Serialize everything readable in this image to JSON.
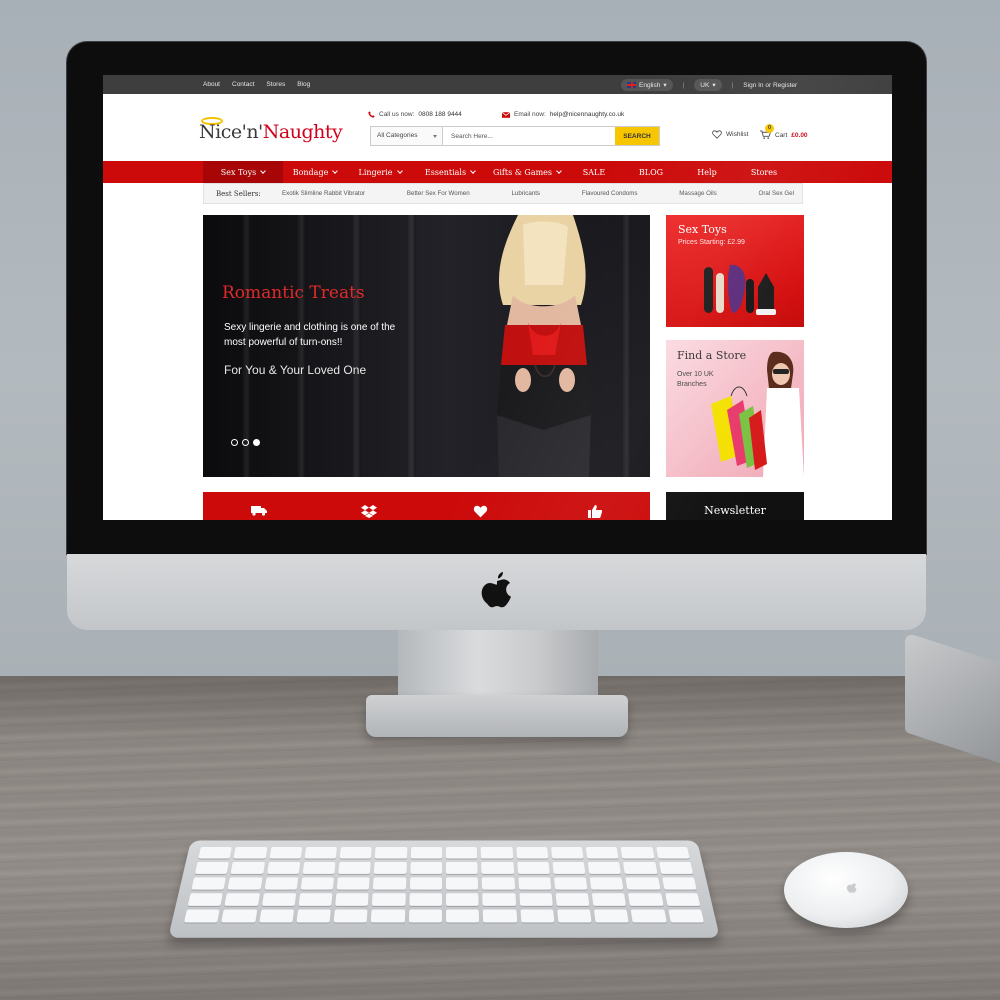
{
  "topbar": {
    "links": [
      "About",
      "Contact",
      "Stores",
      "Blog"
    ],
    "language": "English",
    "region": "UK",
    "sign_in": "Sign In",
    "or": "or",
    "register": "Register"
  },
  "header": {
    "logo": {
      "part1": "Nice",
      "part2": "'n'",
      "part3": "Naughty"
    },
    "call_label": "Call us now:",
    "phone": "0808 188 9444",
    "email_label": "Email now:",
    "email": "help@nicennaughty.co.uk",
    "search_category": "All Categories",
    "search_placeholder": "Search Here...",
    "search_button": "SEARCH",
    "wishlist": "Wishlist",
    "cart_count": "0",
    "cart_label": "Cart",
    "cart_total": "£0.00"
  },
  "nav": {
    "items": [
      {
        "label": "Sex Toys",
        "dropdown": true
      },
      {
        "label": "Bondage",
        "dropdown": true
      },
      {
        "label": "Lingerie",
        "dropdown": true
      },
      {
        "label": "Essentials",
        "dropdown": true
      },
      {
        "label": "Gifts & Games",
        "dropdown": true
      },
      {
        "label": "SALE",
        "dropdown": false
      },
      {
        "label": "BLOG",
        "dropdown": false
      },
      {
        "label": "Help",
        "dropdown": false
      },
      {
        "label": "Stores",
        "dropdown": false
      }
    ]
  },
  "best_sellers": {
    "label": "Best Sellers:",
    "items": [
      "Exotik Slimline Rabbit Vibrator",
      "Better Sex For Women",
      "Lubricants",
      "Flavoured Condoms",
      "Massage Oils",
      "Oral Sex Gel"
    ]
  },
  "hero": {
    "title": "Romantic Treats",
    "subtitle": "Sexy lingerie and clothing is one of the most powerful of turn-ons!!",
    "tagline": "For You & Your Loved One",
    "slide_count": 3,
    "active_slide": 3
  },
  "promos": [
    {
      "title": "Sex Toys",
      "subtitle": "Prices Starting: £2.99"
    },
    {
      "title": "Find a Store",
      "subtitle": "Over 10 UK Branches"
    }
  ],
  "features": {
    "icons": [
      "truck-icon",
      "dropbox-icon",
      "heart-icon",
      "thumbs-up-icon"
    ]
  },
  "newsletter": {
    "title": "Newsletter"
  },
  "colors": {
    "brand_red": "#cc0a0a",
    "accent_yellow": "#f7c600",
    "topbar_dark": "#3e3e3e"
  }
}
